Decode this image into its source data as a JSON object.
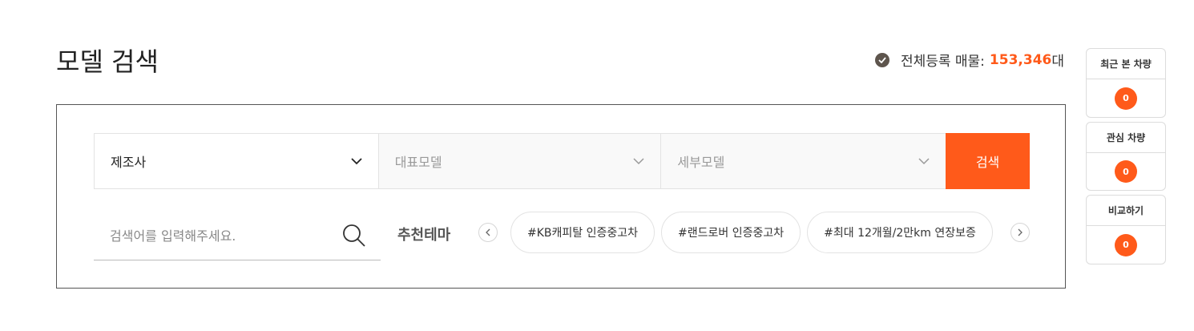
{
  "page": {
    "title": "모델 검색"
  },
  "total": {
    "label": "전체등록 매물:",
    "count": "153,346",
    "unit": "대"
  },
  "filters": {
    "maker": "제조사",
    "model": "대표모델",
    "detail": "세부모델",
    "search_button": "검색"
  },
  "keyword": {
    "placeholder": "검색어를 입력해주세요."
  },
  "themes": {
    "label": "추천테마",
    "tags": [
      "#KB캐피탈 인증중고차",
      "#랜드로버 인증중고차",
      "#최대 12개월/2만km 연장보증"
    ]
  },
  "sidebar": {
    "recent": {
      "label": "최근 본 차량",
      "count": "0"
    },
    "favorite": {
      "label": "관심 차량",
      "count": "0"
    },
    "compare": {
      "label": "비교하기",
      "count": "0"
    }
  },
  "colors": {
    "accent": "#ff5a1a",
    "check_icon": "#5e554d"
  },
  "icons": [
    "check-circle-icon",
    "chevron-down-icon",
    "search-icon",
    "chevron-left-icon",
    "chevron-right-icon"
  ]
}
